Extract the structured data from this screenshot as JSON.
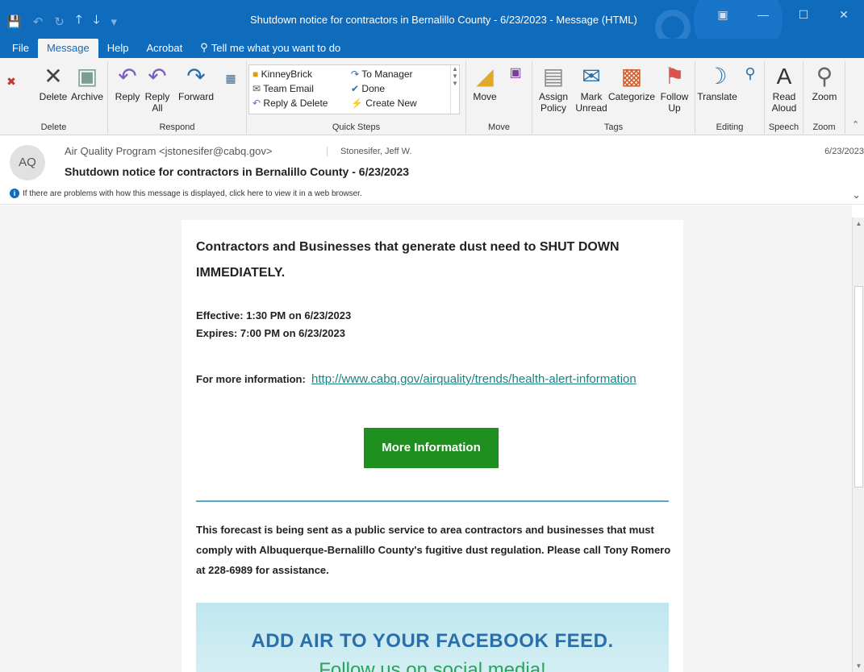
{
  "titlebar": {
    "title": "Shutdown notice for contractors in Bernalillo County - 6/23/2023  -  Message (HTML)",
    "qat": [
      "💾",
      "↶",
      "↻",
      "🡑",
      "🡓",
      "▾"
    ],
    "window_buttons": [
      "▣",
      "—",
      "☐",
      "✕"
    ]
  },
  "menu": {
    "file": "File",
    "message": "Message",
    "help": "Help",
    "acrobat": "Acrobat",
    "tell": "Tell me what you want to do"
  },
  "ribbon": {
    "delete_group": "Delete",
    "delete": "Delete",
    "archive": "Archive",
    "respond_group": "Respond",
    "reply": "Reply",
    "reply_all": "Reply All",
    "forward": "Forward",
    "quicksteps_group": "Quick Steps",
    "qs_kinneybrick": "KinneyBrick",
    "qs_team_email": "Team Email",
    "qs_reply_delete": "Reply & Delete",
    "qs_to_manager": "To Manager",
    "qs_done": "Done",
    "qs_create_new": "Create New",
    "move_group": "Move",
    "move": "Move",
    "tags_group": "Tags",
    "assign_policy": "Assign Policy",
    "mark_unread": "Mark Unread",
    "categorize": "Categorize",
    "follow_up": "Follow Up",
    "editing_group": "Editing",
    "translate": "Translate",
    "speech_group": "Speech",
    "read_aloud": "Read Aloud",
    "zoom_group": "Zoom",
    "zoom": "Zoom"
  },
  "message": {
    "avatar": "AQ",
    "from": "Air Quality Program <jstonesifer@cabq.gov>",
    "to": "Stonesifer, Jeff W.",
    "date": "6/23/2023",
    "subject": "Shutdown notice for contractors in Bernalillo County - 6/23/2023",
    "infobar": "If there are problems with how this message is displayed, click here to view it in a web browser."
  },
  "body": {
    "headline": "Contractors and Businesses that generate dust need to SHUT DOWN IMMEDIATELY.",
    "effective": "Effective: 1:30 PM on 6/23/2023",
    "expires": "Expires: 7:00 PM on 6/23/2023",
    "more_info_label": "For more information:",
    "more_info_link": "http://www.cabq.gov/airquality/trends/health-alert-information",
    "button": "More Information",
    "forecast": "This forecast is being sent as a public service to area contractors and businesses that must comply with Albuquerque-Bernalillo County's fugitive dust regulation.  Please call Tony Romero at 228-6989 for assistance.",
    "banner_line1": "ADD AIR TO YOUR FACEBOOK FEED.",
    "banner_line2": "Follow us on social media!"
  },
  "colors": {
    "accent": "#0f6cbd",
    "button_green": "#1e8f1e",
    "link": "#1f8080"
  }
}
